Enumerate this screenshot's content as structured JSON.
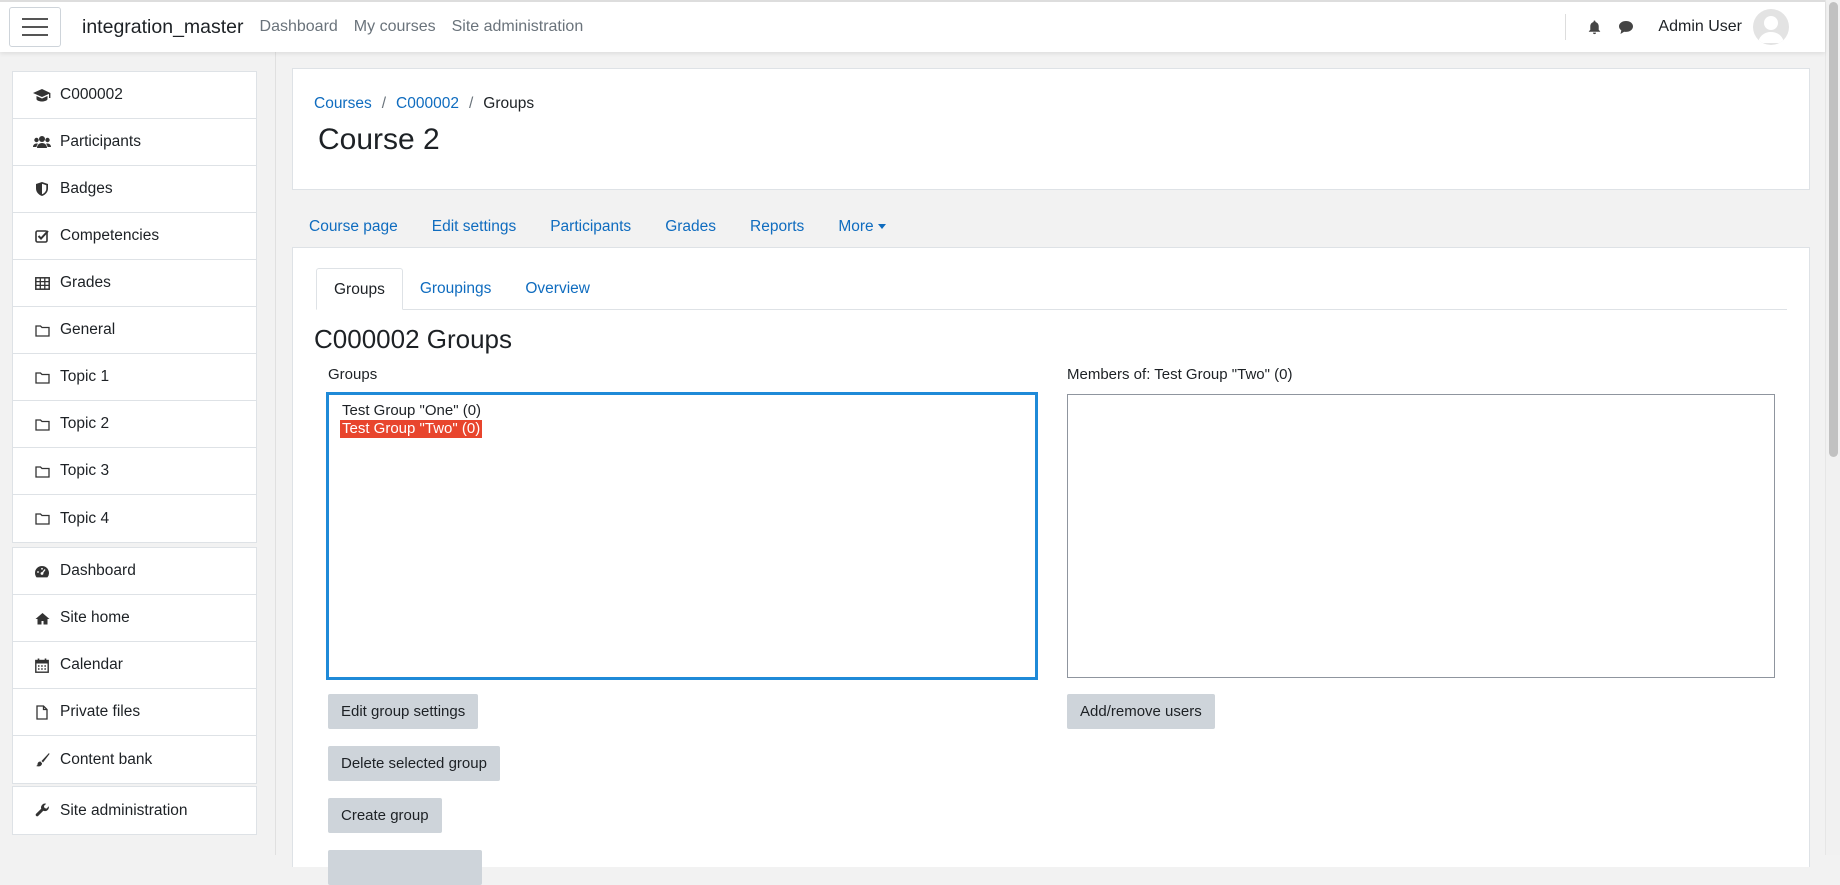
{
  "navbar": {
    "brand": "integration_master",
    "links": [
      "Dashboard",
      "My courses",
      "Site administration"
    ],
    "user_name": "Admin User"
  },
  "sidebar": {
    "course_items": [
      {
        "label": "C000002",
        "icon": "graduation-cap-icon"
      },
      {
        "label": "Participants",
        "icon": "users-icon"
      },
      {
        "label": "Badges",
        "icon": "shield-icon"
      },
      {
        "label": "Competencies",
        "icon": "check-square-icon"
      },
      {
        "label": "Grades",
        "icon": "table-icon"
      },
      {
        "label": "General",
        "icon": "folder-icon"
      },
      {
        "label": "Topic 1",
        "icon": "folder-icon"
      },
      {
        "label": "Topic 2",
        "icon": "folder-icon"
      },
      {
        "label": "Topic 3",
        "icon": "folder-icon"
      },
      {
        "label": "Topic 4",
        "icon": "folder-icon"
      }
    ],
    "site_items": [
      {
        "label": "Dashboard",
        "icon": "dashboard-icon"
      },
      {
        "label": "Site home",
        "icon": "home-icon"
      },
      {
        "label": "Calendar",
        "icon": "calendar-icon"
      },
      {
        "label": "Private files",
        "icon": "file-icon"
      },
      {
        "label": "Content bank",
        "icon": "brush-icon"
      }
    ],
    "admin_item": {
      "label": "Site administration",
      "icon": "wrench-icon"
    }
  },
  "header": {
    "breadcrumb": [
      "Courses",
      "C000002",
      "Groups"
    ],
    "title": "Course 2"
  },
  "secondary_nav": [
    "Course page",
    "Edit settings",
    "Participants",
    "Grades",
    "Reports",
    "More"
  ],
  "tabs": [
    "Groups",
    "Groupings",
    "Overview"
  ],
  "main": {
    "section_title": "C000002 Groups",
    "groups_label": "Groups",
    "groups": [
      {
        "label": "Test Group \"One\" (0)",
        "selected": false
      },
      {
        "label": "Test Group \"Two\" (0)",
        "selected": true
      }
    ],
    "members_label": "Members of: Test Group \"Two\" (0)",
    "buttons": {
      "edit_group": "Edit group settings",
      "delete_group": "Delete selected group",
      "create_group": "Create group",
      "add_remove_users": "Add/remove users"
    }
  },
  "colors": {
    "link": "#0f6cbf",
    "selected_option": "#e8452d",
    "listbox_focus": "#1f8ad8",
    "button_bg": "#ced4da"
  }
}
